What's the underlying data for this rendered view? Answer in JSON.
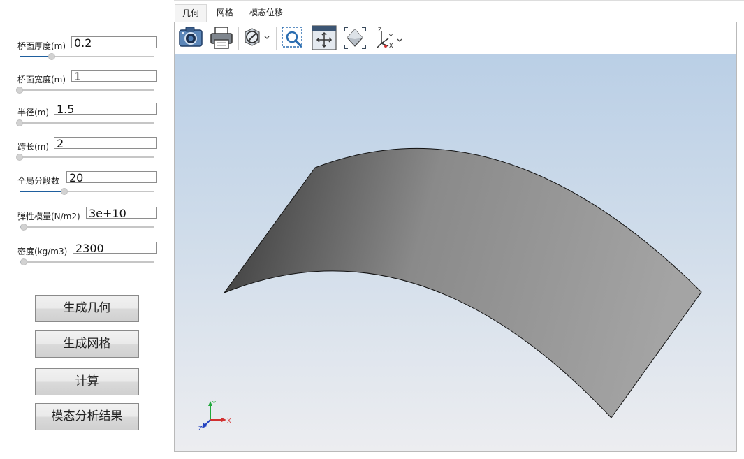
{
  "params": [
    {
      "label": "桥面厚度(m)",
      "value": "0.2",
      "slider": 0.24
    },
    {
      "label": "桥面宽度(m)",
      "value": "1",
      "slider": 0.0
    },
    {
      "label": "半径(m)",
      "value": "1.5",
      "slider": 0.0
    },
    {
      "label": "跨长(m)",
      "value": "2",
      "slider": 0.0
    },
    {
      "label": "全局分段数",
      "value": "20",
      "slider": 0.33
    },
    {
      "label": "弹性模量(N/m2)",
      "value": "3e+10",
      "slider": 0.03
    },
    {
      "label": "密度(kg/m3)",
      "value": "2300",
      "slider": 0.03
    }
  ],
  "buttons": {
    "generate_geometry": "生成几何",
    "generate_mesh": "生成网格",
    "compute": "计算",
    "modal_results": "模态分析结果"
  },
  "tabs": [
    {
      "label": "几何",
      "active": true
    },
    {
      "label": "网格",
      "active": false
    },
    {
      "label": "模态位移",
      "active": false
    }
  ],
  "toolbar": {
    "icons": [
      "camera-icon",
      "printer-icon",
      "hide-show-icon",
      "zoom-window-icon",
      "pan-fit-icon",
      "fit-all-icon",
      "view-axes-icon"
    ]
  },
  "axes": {
    "x": "X",
    "y": "Y",
    "z": "Z"
  },
  "colors": {
    "slider_fill": "#1f5f9e",
    "viewport_top": "#bacfe6",
    "viewport_bottom": "#ecedf0",
    "surface_dark": "#3a3a3a",
    "surface_light": "#a2a2a2"
  }
}
